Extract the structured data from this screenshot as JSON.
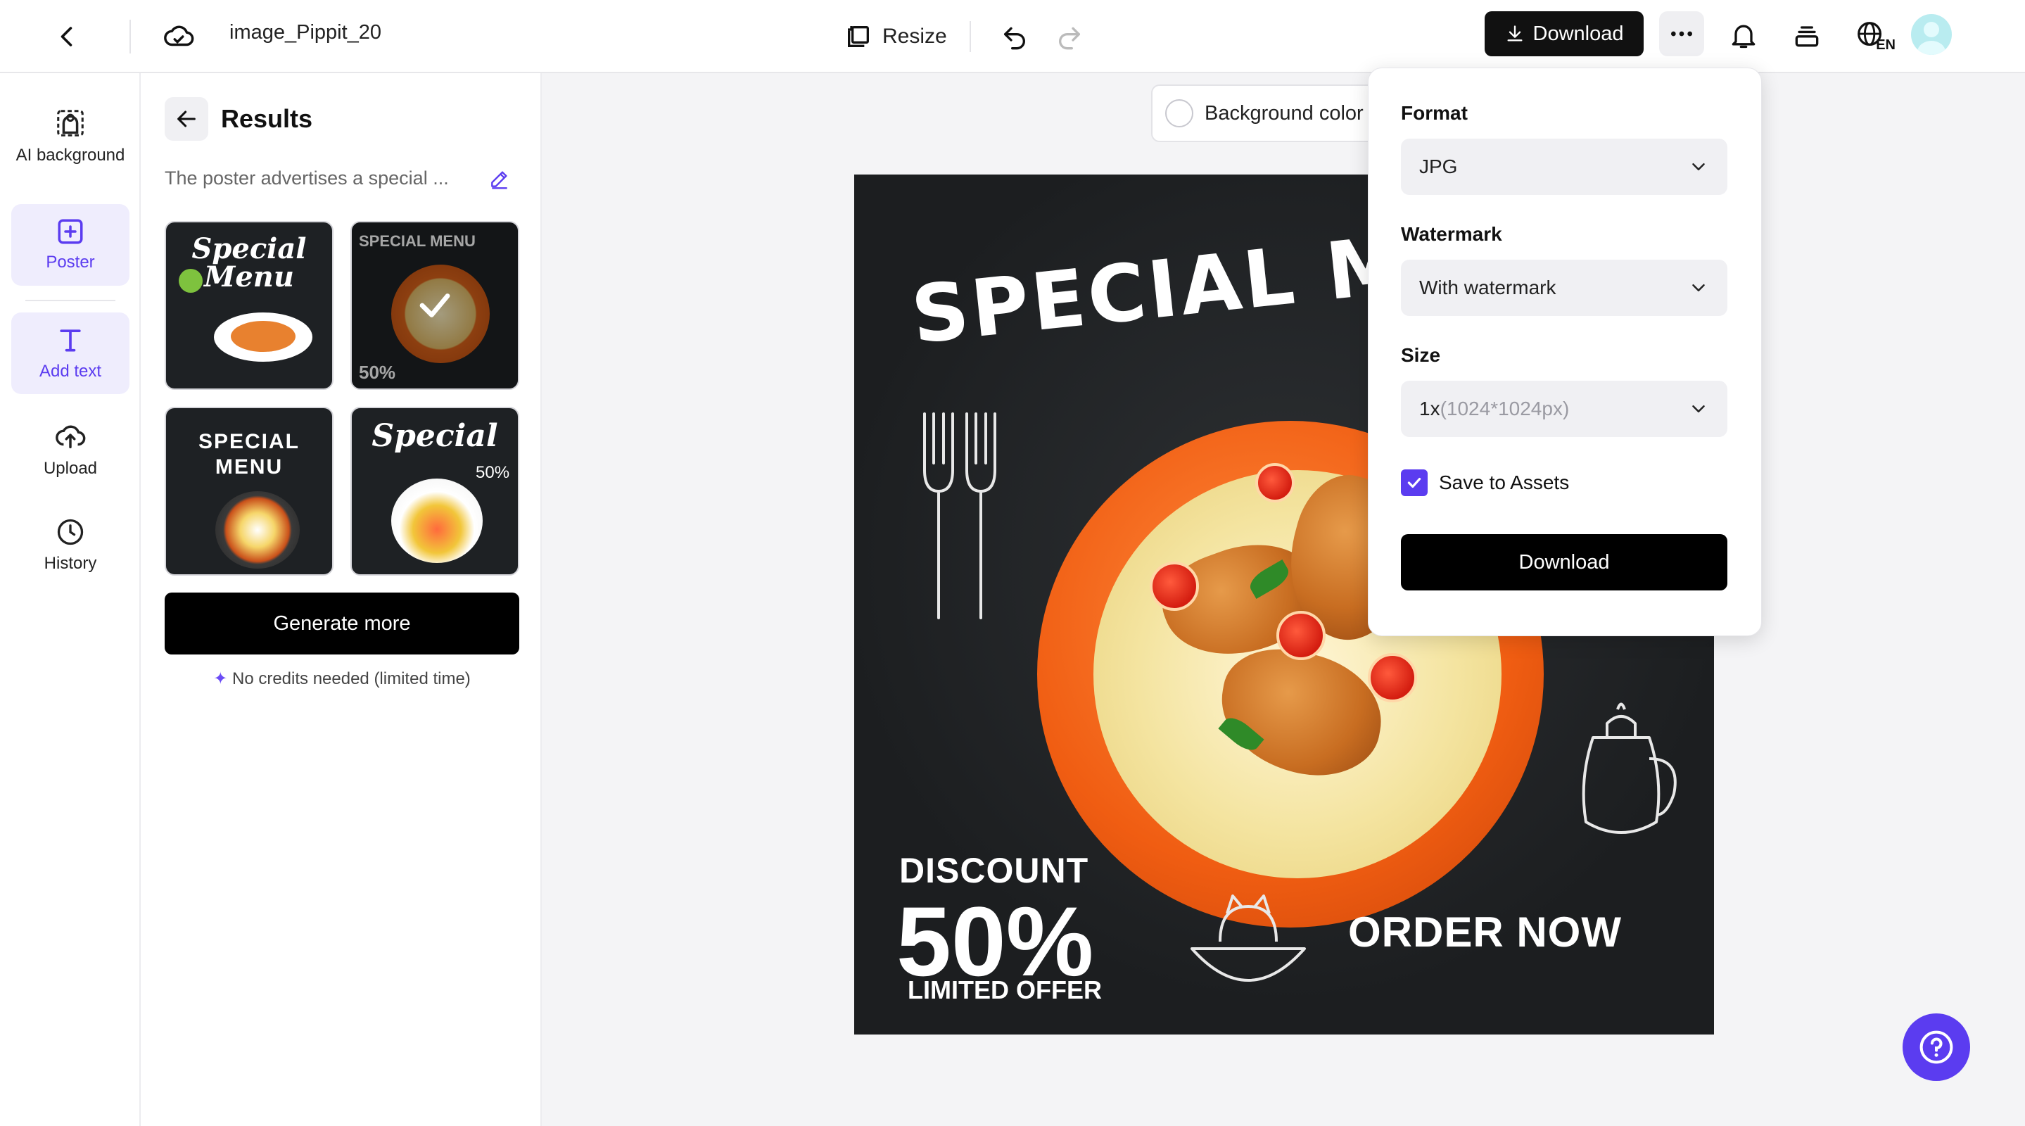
{
  "topbar": {
    "file_name": "image_Pippit_20",
    "resize_label": "Resize",
    "download_label": "Download",
    "lang_code": "EN",
    "icons": [
      "back-icon",
      "cloud-save-icon",
      "resize-icon",
      "undo-icon",
      "redo-icon",
      "download-icon",
      "more-icon",
      "bell-icon",
      "layers-icon",
      "globe-icon",
      "avatar"
    ]
  },
  "rail": {
    "items": [
      {
        "label": "AI background",
        "icon": "ai-background-icon"
      },
      {
        "label": "Poster",
        "icon": "poster-icon",
        "active": true
      },
      {
        "label": "Add text",
        "icon": "text-icon"
      },
      {
        "label": "Upload",
        "icon": "upload-icon"
      },
      {
        "label": "History",
        "icon": "history-icon"
      }
    ]
  },
  "panel": {
    "title": "Results",
    "prompt": "The poster advertises a special ...",
    "generate_label": "Generate more",
    "credits_note": "No credits needed (limited time)",
    "thumbnails": [
      {
        "title": "Special Menu",
        "selected": false
      },
      {
        "title": "SPECIAL MENU",
        "badge": "50%",
        "selected": true
      },
      {
        "title": "SPECIAL MENU",
        "selected": false
      },
      {
        "title": "Special",
        "badge": "50%",
        "selected": false
      }
    ]
  },
  "canvas": {
    "bg_color_label": "Background color",
    "poster": {
      "headline": "SPECIAL MEN",
      "discount": "DISCOUNT",
      "percent": "50%",
      "limited": "LIMITED OFFER",
      "cta": "ORDER NOW"
    }
  },
  "download_popover": {
    "format_label": "Format",
    "format_value": "JPG",
    "watermark_label": "Watermark",
    "watermark_value": "With watermark",
    "size_label": "Size",
    "size_value": "1x",
    "size_detail": "(1024*1024px)",
    "save_assets_label": "Save to Assets",
    "save_assets_checked": true,
    "download_label": "Download"
  },
  "colors": {
    "accent": "#5b3cf0",
    "primary_button": "#000000",
    "poster_bg": "#1c1e20",
    "bowl": "#f05d12"
  }
}
